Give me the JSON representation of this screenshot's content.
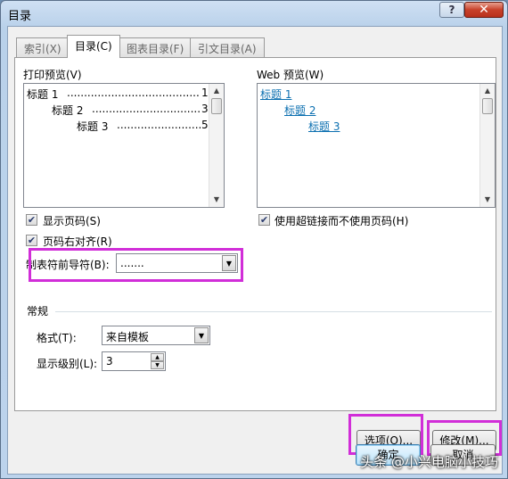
{
  "window": {
    "title": "目录",
    "help_glyph": "?",
    "close_glyph": "✕"
  },
  "tabs": [
    {
      "label": "索引(X)"
    },
    {
      "label": "目录(C)"
    },
    {
      "label": "图表目录(F)"
    },
    {
      "label": "引文目录(A)"
    }
  ],
  "print_preview": {
    "label": "打印预览(V)",
    "entries": [
      {
        "text": "标题 1",
        "page": "1"
      },
      {
        "text": "标题 2",
        "page": "3"
      },
      {
        "text": "标题 3",
        "page": "5"
      }
    ]
  },
  "web_preview": {
    "label": "Web 预览(W)",
    "entries": [
      "标题 1",
      "标题 2",
      "标题 3"
    ]
  },
  "options": {
    "show_page_numbers": {
      "label": "显示页码(S)",
      "checked": true
    },
    "right_align": {
      "label": "页码右对齐(R)",
      "checked": true
    },
    "use_hyperlinks": {
      "label": "使用超链接而不使用页码(H)",
      "checked": true
    },
    "tab_leader": {
      "label": "制表符前导符(B):",
      "value": "......."
    }
  },
  "general": {
    "label": "常规",
    "format": {
      "label": "格式(T):",
      "value": "来自模板"
    },
    "levels": {
      "label": "显示级别(L):",
      "value": "3"
    }
  },
  "buttons": {
    "options": "选项(O)...",
    "modify": "修改(M)...",
    "ok": "确定",
    "cancel": "取消"
  },
  "watermark": "头条 @小兴电脑小技巧"
}
